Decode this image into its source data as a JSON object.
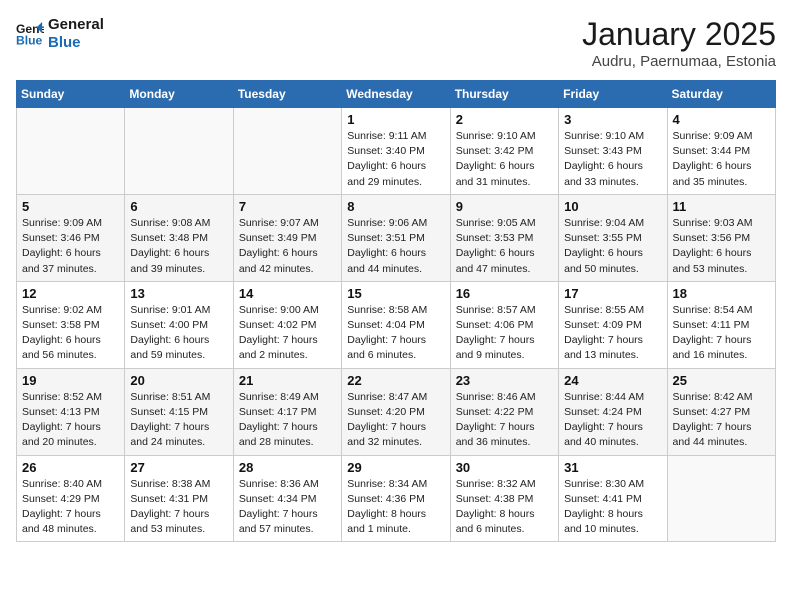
{
  "logo": {
    "line1": "General",
    "line2": "Blue"
  },
  "title": "January 2025",
  "subtitle": "Audru, Paernumaa, Estonia",
  "days_header": [
    "Sunday",
    "Monday",
    "Tuesday",
    "Wednesday",
    "Thursday",
    "Friday",
    "Saturday"
  ],
  "weeks": [
    [
      {
        "num": "",
        "detail": ""
      },
      {
        "num": "",
        "detail": ""
      },
      {
        "num": "",
        "detail": ""
      },
      {
        "num": "1",
        "detail": "Sunrise: 9:11 AM\nSunset: 3:40 PM\nDaylight: 6 hours and 29 minutes."
      },
      {
        "num": "2",
        "detail": "Sunrise: 9:10 AM\nSunset: 3:42 PM\nDaylight: 6 hours and 31 minutes."
      },
      {
        "num": "3",
        "detail": "Sunrise: 9:10 AM\nSunset: 3:43 PM\nDaylight: 6 hours and 33 minutes."
      },
      {
        "num": "4",
        "detail": "Sunrise: 9:09 AM\nSunset: 3:44 PM\nDaylight: 6 hours and 35 minutes."
      }
    ],
    [
      {
        "num": "5",
        "detail": "Sunrise: 9:09 AM\nSunset: 3:46 PM\nDaylight: 6 hours and 37 minutes."
      },
      {
        "num": "6",
        "detail": "Sunrise: 9:08 AM\nSunset: 3:48 PM\nDaylight: 6 hours and 39 minutes."
      },
      {
        "num": "7",
        "detail": "Sunrise: 9:07 AM\nSunset: 3:49 PM\nDaylight: 6 hours and 42 minutes."
      },
      {
        "num": "8",
        "detail": "Sunrise: 9:06 AM\nSunset: 3:51 PM\nDaylight: 6 hours and 44 minutes."
      },
      {
        "num": "9",
        "detail": "Sunrise: 9:05 AM\nSunset: 3:53 PM\nDaylight: 6 hours and 47 minutes."
      },
      {
        "num": "10",
        "detail": "Sunrise: 9:04 AM\nSunset: 3:55 PM\nDaylight: 6 hours and 50 minutes."
      },
      {
        "num": "11",
        "detail": "Sunrise: 9:03 AM\nSunset: 3:56 PM\nDaylight: 6 hours and 53 minutes."
      }
    ],
    [
      {
        "num": "12",
        "detail": "Sunrise: 9:02 AM\nSunset: 3:58 PM\nDaylight: 6 hours and 56 minutes."
      },
      {
        "num": "13",
        "detail": "Sunrise: 9:01 AM\nSunset: 4:00 PM\nDaylight: 6 hours and 59 minutes."
      },
      {
        "num": "14",
        "detail": "Sunrise: 9:00 AM\nSunset: 4:02 PM\nDaylight: 7 hours and 2 minutes."
      },
      {
        "num": "15",
        "detail": "Sunrise: 8:58 AM\nSunset: 4:04 PM\nDaylight: 7 hours and 6 minutes."
      },
      {
        "num": "16",
        "detail": "Sunrise: 8:57 AM\nSunset: 4:06 PM\nDaylight: 7 hours and 9 minutes."
      },
      {
        "num": "17",
        "detail": "Sunrise: 8:55 AM\nSunset: 4:09 PM\nDaylight: 7 hours and 13 minutes."
      },
      {
        "num": "18",
        "detail": "Sunrise: 8:54 AM\nSunset: 4:11 PM\nDaylight: 7 hours and 16 minutes."
      }
    ],
    [
      {
        "num": "19",
        "detail": "Sunrise: 8:52 AM\nSunset: 4:13 PM\nDaylight: 7 hours and 20 minutes."
      },
      {
        "num": "20",
        "detail": "Sunrise: 8:51 AM\nSunset: 4:15 PM\nDaylight: 7 hours and 24 minutes."
      },
      {
        "num": "21",
        "detail": "Sunrise: 8:49 AM\nSunset: 4:17 PM\nDaylight: 7 hours and 28 minutes."
      },
      {
        "num": "22",
        "detail": "Sunrise: 8:47 AM\nSunset: 4:20 PM\nDaylight: 7 hours and 32 minutes."
      },
      {
        "num": "23",
        "detail": "Sunrise: 8:46 AM\nSunset: 4:22 PM\nDaylight: 7 hours and 36 minutes."
      },
      {
        "num": "24",
        "detail": "Sunrise: 8:44 AM\nSunset: 4:24 PM\nDaylight: 7 hours and 40 minutes."
      },
      {
        "num": "25",
        "detail": "Sunrise: 8:42 AM\nSunset: 4:27 PM\nDaylight: 7 hours and 44 minutes."
      }
    ],
    [
      {
        "num": "26",
        "detail": "Sunrise: 8:40 AM\nSunset: 4:29 PM\nDaylight: 7 hours and 48 minutes."
      },
      {
        "num": "27",
        "detail": "Sunrise: 8:38 AM\nSunset: 4:31 PM\nDaylight: 7 hours and 53 minutes."
      },
      {
        "num": "28",
        "detail": "Sunrise: 8:36 AM\nSunset: 4:34 PM\nDaylight: 7 hours and 57 minutes."
      },
      {
        "num": "29",
        "detail": "Sunrise: 8:34 AM\nSunset: 4:36 PM\nDaylight: 8 hours and 1 minute."
      },
      {
        "num": "30",
        "detail": "Sunrise: 8:32 AM\nSunset: 4:38 PM\nDaylight: 8 hours and 6 minutes."
      },
      {
        "num": "31",
        "detail": "Sunrise: 8:30 AM\nSunset: 4:41 PM\nDaylight: 8 hours and 10 minutes."
      },
      {
        "num": "",
        "detail": ""
      }
    ]
  ]
}
